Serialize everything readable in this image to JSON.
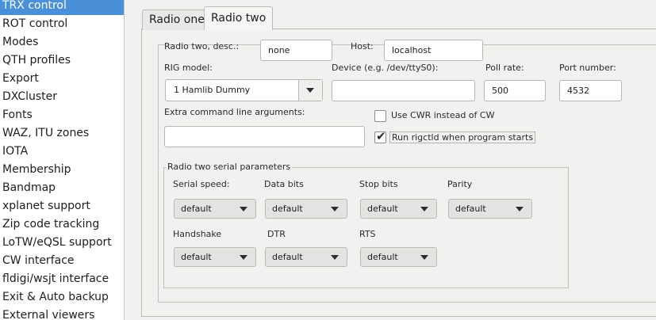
{
  "sidebar": {
    "items": [
      {
        "label": "TRX control",
        "selected": true
      },
      {
        "label": "ROT control"
      },
      {
        "label": "Modes"
      },
      {
        "label": "QTH profiles"
      },
      {
        "label": "Export"
      },
      {
        "label": "DXCluster"
      },
      {
        "label": "Fonts"
      },
      {
        "label": "WAZ, ITU zones"
      },
      {
        "label": "IOTA"
      },
      {
        "label": "Membership"
      },
      {
        "label": "Bandmap"
      },
      {
        "label": "xplanet support"
      },
      {
        "label": "Zip code tracking"
      },
      {
        "label": "LoTW/eQSL support"
      },
      {
        "label": "CW interface"
      },
      {
        "label": "fldigi/wsjt interface"
      },
      {
        "label": "Exit & Auto backup"
      },
      {
        "label": "External viewers"
      }
    ]
  },
  "tabs": [
    {
      "label": "Radio one"
    },
    {
      "label": "Radio two",
      "active": true
    }
  ],
  "radio": {
    "desc_label": "Radio two, desc.:",
    "desc_value": "none",
    "host_label": "Host:",
    "host_value": "localhost",
    "rig_model_label": "RIG model:",
    "rig_model_value": "1 Hamlib Dummy",
    "device_label": "Device (e.g. /dev/ttyS0):",
    "device_value": "",
    "poll_rate_label": "Poll rate:",
    "poll_rate_value": "500",
    "port_label": "Port number:",
    "port_value": "4532",
    "extra_args_label": "Extra command line arguments:",
    "extra_args_value": "",
    "use_cwr_label": "Use CWR instead of CW",
    "use_cwr_checked": false,
    "run_rigctld_label": "Run rigctld when program starts",
    "run_rigctld_checked": true
  },
  "serial": {
    "legend": "Radio two serial parameters",
    "serial_speed_label": "Serial speed:",
    "serial_speed_value": "default",
    "data_bits_label": "Data bits",
    "data_bits_value": "default",
    "stop_bits_label": "Stop bits",
    "stop_bits_value": "default",
    "parity_label": "Parity",
    "parity_value": "default",
    "handshake_label": "Handshake",
    "handshake_value": "default",
    "dtr_label": "DTR",
    "dtr_value": "default",
    "rts_label": "RTS",
    "rts_value": "default"
  },
  "icons": {
    "dropdown": "chevron-down-icon",
    "check": "check-icon"
  }
}
